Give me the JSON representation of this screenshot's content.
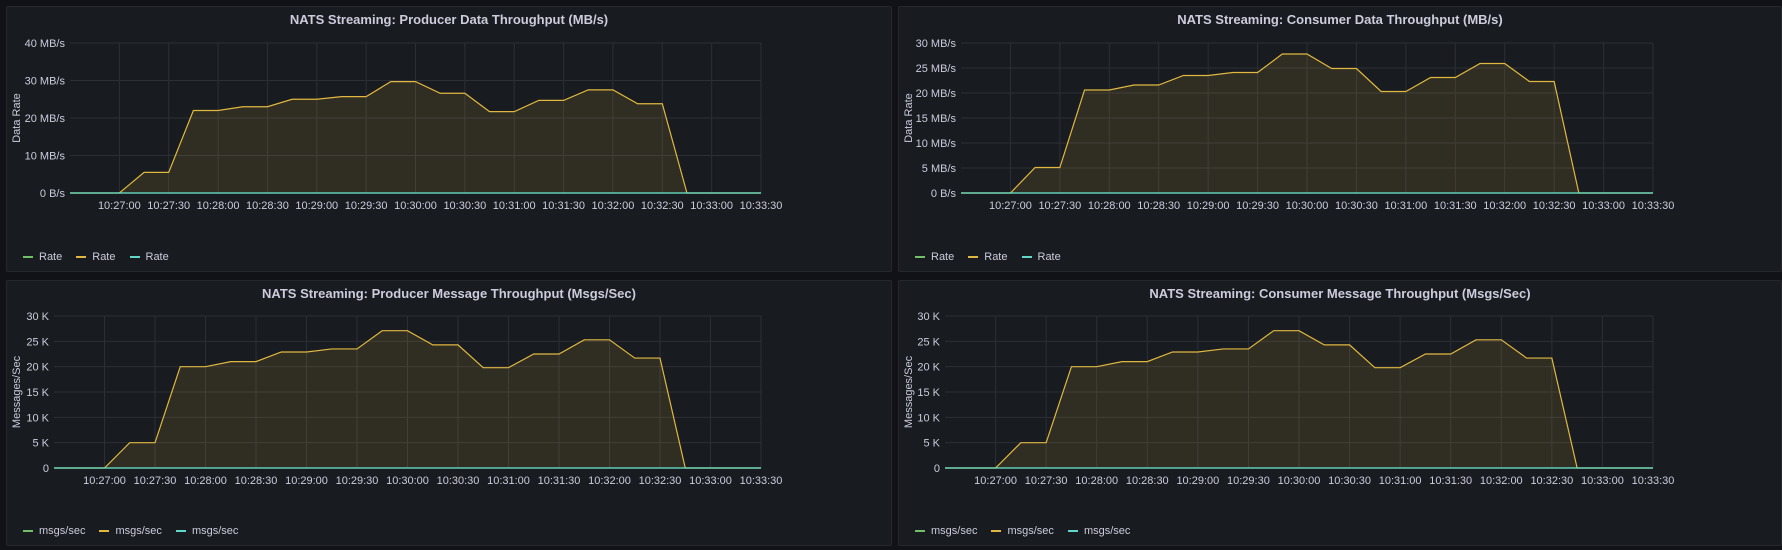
{
  "dashboard": {
    "panels": [
      {
        "title": "NATS Streaming: Producer Data Throughput (MB/s)",
        "legend": [
          {
            "label": "Rate",
            "color": "#73bf69"
          },
          {
            "label": "Rate",
            "color": "#e0b840"
          },
          {
            "label": "Rate",
            "color": "#5fd8c8"
          }
        ]
      },
      {
        "title": "NATS Streaming: Consumer Data Throughput (MB/s)",
        "legend": [
          {
            "label": "Rate",
            "color": "#73bf69"
          },
          {
            "label": "Rate",
            "color": "#e0b840"
          },
          {
            "label": "Rate",
            "color": "#5fd8c8"
          }
        ]
      },
      {
        "title": "NATS Streaming: Producer Message Throughput (Msgs/Sec)",
        "legend": [
          {
            "label": "msgs/sec",
            "color": "#73bf69"
          },
          {
            "label": "msgs/sec",
            "color": "#e0b840"
          },
          {
            "label": "msgs/sec",
            "color": "#5fd8c8"
          }
        ]
      },
      {
        "title": "NATS Streaming: Consumer Message Throughput (Msgs/Sec)",
        "legend": [
          {
            "label": "msgs/sec",
            "color": "#73bf69"
          },
          {
            "label": "msgs/sec",
            "color": "#e0b840"
          },
          {
            "label": "msgs/sec",
            "color": "#5fd8c8"
          }
        ]
      }
    ]
  },
  "chart_data": [
    {
      "type": "area",
      "title": "NATS Streaming: Producer Data Throughput (MB/s)",
      "ylabel": "Data Rate",
      "xlabel": "",
      "x": [
        "10:26:30",
        "10:26:45",
        "10:27:00",
        "10:27:15",
        "10:27:30",
        "10:27:45",
        "10:28:00",
        "10:28:15",
        "10:28:30",
        "10:28:45",
        "10:29:00",
        "10:29:15",
        "10:29:30",
        "10:29:45",
        "10:30:00",
        "10:30:15",
        "10:30:30",
        "10:30:45",
        "10:31:00",
        "10:31:15",
        "10:31:30",
        "10:31:45",
        "10:32:00",
        "10:32:15",
        "10:32:30",
        "10:32:45",
        "10:33:00",
        "10:33:15",
        "10:33:30"
      ],
      "xlim": [
        "10:26:30",
        "10:33:30"
      ],
      "ylim": [
        0,
        40
      ],
      "xticks": [
        "10:27:00",
        "10:27:30",
        "10:28:00",
        "10:28:30",
        "10:29:00",
        "10:29:30",
        "10:30:00",
        "10:30:30",
        "10:31:00",
        "10:31:30",
        "10:32:00",
        "10:32:30",
        "10:33:00",
        "10:33:30"
      ],
      "yticks": [
        0,
        10,
        20,
        30,
        40
      ],
      "ytick_labels": [
        "0 B/s",
        "10 MB/s",
        "20 MB/s",
        "30 MB/s",
        "40 MB/s"
      ],
      "series": [
        {
          "color": "#73bf69",
          "values": [
            0,
            0,
            0,
            0,
            0,
            0,
            0,
            0,
            0,
            0,
            0,
            0,
            0,
            0,
            0,
            0,
            0,
            0,
            0,
            0,
            0,
            0,
            0,
            0,
            0,
            0,
            0,
            0,
            0
          ]
        },
        {
          "color": "#e0b840",
          "fill": true,
          "values": [
            0,
            0,
            0,
            5.5,
            5.5,
            22,
            22,
            23,
            23,
            25,
            25,
            25.7,
            25.7,
            29.7,
            29.7,
            26.6,
            26.6,
            21.7,
            21.7,
            24.7,
            24.7,
            27.5,
            27.5,
            23.8,
            23.8,
            0,
            0,
            0,
            0
          ]
        },
        {
          "color": "#5fd8c8",
          "values": [
            0,
            0,
            0,
            0,
            0,
            0,
            0,
            0,
            0,
            0,
            0,
            0,
            0,
            0,
            0,
            0,
            0,
            0,
            0,
            0,
            0,
            0,
            0,
            0,
            0,
            0,
            0,
            0,
            0
          ]
        }
      ],
      "grid": true,
      "legend_position": "bottom-left"
    },
    {
      "type": "area",
      "title": "NATS Streaming: Consumer Data Throughput (MB/s)",
      "ylabel": "Data Rate",
      "xlabel": "",
      "x": [
        "10:26:30",
        "10:26:45",
        "10:27:00",
        "10:27:15",
        "10:27:30",
        "10:27:45",
        "10:28:00",
        "10:28:15",
        "10:28:30",
        "10:28:45",
        "10:29:00",
        "10:29:15",
        "10:29:30",
        "10:29:45",
        "10:30:00",
        "10:30:15",
        "10:30:30",
        "10:30:45",
        "10:31:00",
        "10:31:15",
        "10:31:30",
        "10:31:45",
        "10:32:00",
        "10:32:15",
        "10:32:30",
        "10:32:45",
        "10:33:00",
        "10:33:15",
        "10:33:30"
      ],
      "xlim": [
        "10:26:30",
        "10:33:30"
      ],
      "ylim": [
        0,
        30
      ],
      "xticks": [
        "10:27:00",
        "10:27:30",
        "10:28:00",
        "10:28:30",
        "10:29:00",
        "10:29:30",
        "10:30:00",
        "10:30:30",
        "10:31:00",
        "10:31:30",
        "10:32:00",
        "10:32:30",
        "10:33:00",
        "10:33:30"
      ],
      "yticks": [
        0,
        5,
        10,
        15,
        20,
        25,
        30
      ],
      "ytick_labels": [
        "0 B/s",
        "5 MB/s",
        "10 MB/s",
        "15 MB/s",
        "20 MB/s",
        "25 MB/s",
        "30 MB/s"
      ],
      "series": [
        {
          "color": "#73bf69",
          "values": [
            0,
            0,
            0,
            0,
            0,
            0,
            0,
            0,
            0,
            0,
            0,
            0,
            0,
            0,
            0,
            0,
            0,
            0,
            0,
            0,
            0,
            0,
            0,
            0,
            0,
            0,
            0,
            0,
            0
          ]
        },
        {
          "color": "#e0b840",
          "fill": true,
          "values": [
            0,
            0,
            0,
            5.1,
            5.1,
            20.6,
            20.6,
            21.6,
            21.6,
            23.5,
            23.5,
            24.1,
            24.1,
            27.8,
            27.8,
            24.9,
            24.9,
            20.3,
            20.3,
            23.1,
            23.1,
            25.9,
            25.9,
            22.3,
            22.3,
            0,
            0,
            0,
            0
          ]
        },
        {
          "color": "#5fd8c8",
          "values": [
            0,
            0,
            0,
            0,
            0,
            0,
            0,
            0,
            0,
            0,
            0,
            0,
            0,
            0,
            0,
            0,
            0,
            0,
            0,
            0,
            0,
            0,
            0,
            0,
            0,
            0,
            0,
            0,
            0
          ]
        }
      ],
      "grid": true,
      "legend_position": "bottom-left"
    },
    {
      "type": "area",
      "title": "NATS Streaming: Producer Message Throughput (Msgs/Sec)",
      "ylabel": "Messages/Sec",
      "xlabel": "",
      "x": [
        "10:26:30",
        "10:26:45",
        "10:27:00",
        "10:27:15",
        "10:27:30",
        "10:27:45",
        "10:28:00",
        "10:28:15",
        "10:28:30",
        "10:28:45",
        "10:29:00",
        "10:29:15",
        "10:29:30",
        "10:29:45",
        "10:30:00",
        "10:30:15",
        "10:30:30",
        "10:30:45",
        "10:31:00",
        "10:31:15",
        "10:31:30",
        "10:31:45",
        "10:32:00",
        "10:32:15",
        "10:32:30",
        "10:32:45",
        "10:33:00",
        "10:33:15",
        "10:33:30"
      ],
      "xlim": [
        "10:26:30",
        "10:33:30"
      ],
      "ylim": [
        0,
        30000
      ],
      "xticks": [
        "10:27:00",
        "10:27:30",
        "10:28:00",
        "10:28:30",
        "10:29:00",
        "10:29:30",
        "10:30:00",
        "10:30:30",
        "10:31:00",
        "10:31:30",
        "10:32:00",
        "10:32:30",
        "10:33:00",
        "10:33:30"
      ],
      "yticks": [
        0,
        5000,
        10000,
        15000,
        20000,
        25000,
        30000
      ],
      "ytick_labels": [
        "0",
        "5 K",
        "10 K",
        "15 K",
        "20 K",
        "25 K",
        "30 K"
      ],
      "series": [
        {
          "color": "#73bf69",
          "values": [
            0,
            0,
            0,
            0,
            0,
            0,
            0,
            0,
            0,
            0,
            0,
            0,
            0,
            0,
            0,
            0,
            0,
            0,
            0,
            0,
            0,
            0,
            0,
            0,
            0,
            0,
            0,
            0,
            0
          ]
        },
        {
          "color": "#e0b840",
          "fill": true,
          "values": [
            0,
            0,
            0,
            5000,
            5000,
            20000,
            20000,
            21000,
            21000,
            22900,
            22900,
            23500,
            23500,
            27100,
            27100,
            24300,
            24300,
            19800,
            19800,
            22500,
            22500,
            25300,
            25300,
            21700,
            21700,
            0,
            0,
            0,
            0
          ]
        },
        {
          "color": "#5fd8c8",
          "values": [
            0,
            0,
            0,
            0,
            0,
            0,
            0,
            0,
            0,
            0,
            0,
            0,
            0,
            0,
            0,
            0,
            0,
            0,
            0,
            0,
            0,
            0,
            0,
            0,
            0,
            0,
            0,
            0,
            0
          ]
        }
      ],
      "grid": true,
      "legend_position": "bottom-left"
    },
    {
      "type": "area",
      "title": "NATS Streaming: Consumer Message Throughput (Msgs/Sec)",
      "ylabel": "Messages/Sec",
      "xlabel": "",
      "x": [
        "10:26:30",
        "10:26:45",
        "10:27:00",
        "10:27:15",
        "10:27:30",
        "10:27:45",
        "10:28:00",
        "10:28:15",
        "10:28:30",
        "10:28:45",
        "10:29:00",
        "10:29:15",
        "10:29:30",
        "10:29:45",
        "10:30:00",
        "10:30:15",
        "10:30:30",
        "10:30:45",
        "10:31:00",
        "10:31:15",
        "10:31:30",
        "10:31:45",
        "10:32:00",
        "10:32:15",
        "10:32:30",
        "10:32:45",
        "10:33:00",
        "10:33:15",
        "10:33:30"
      ],
      "xlim": [
        "10:26:30",
        "10:33:30"
      ],
      "ylim": [
        0,
        30000
      ],
      "xticks": [
        "10:27:00",
        "10:27:30",
        "10:28:00",
        "10:28:30",
        "10:29:00",
        "10:29:30",
        "10:30:00",
        "10:30:30",
        "10:31:00",
        "10:31:30",
        "10:32:00",
        "10:32:30",
        "10:33:00",
        "10:33:30"
      ],
      "yticks": [
        0,
        5000,
        10000,
        15000,
        20000,
        25000,
        30000
      ],
      "ytick_labels": [
        "0",
        "5 K",
        "10 K",
        "15 K",
        "20 K",
        "25 K",
        "30 K"
      ],
      "series": [
        {
          "color": "#73bf69",
          "values": [
            0,
            0,
            0,
            0,
            0,
            0,
            0,
            0,
            0,
            0,
            0,
            0,
            0,
            0,
            0,
            0,
            0,
            0,
            0,
            0,
            0,
            0,
            0,
            0,
            0,
            0,
            0,
            0,
            0
          ]
        },
        {
          "color": "#e0b840",
          "fill": true,
          "values": [
            0,
            0,
            0,
            5000,
            5000,
            20000,
            20000,
            21000,
            21000,
            22900,
            22900,
            23500,
            23500,
            27100,
            27100,
            24300,
            24300,
            19800,
            19800,
            22500,
            22500,
            25300,
            25300,
            21700,
            21700,
            0,
            0,
            0,
            0
          ]
        },
        {
          "color": "#5fd8c8",
          "values": [
            0,
            0,
            0,
            0,
            0,
            0,
            0,
            0,
            0,
            0,
            0,
            0,
            0,
            0,
            0,
            0,
            0,
            0,
            0,
            0,
            0,
            0,
            0,
            0,
            0,
            0,
            0,
            0,
            0
          ]
        }
      ],
      "grid": true,
      "legend_position": "bottom-left"
    }
  ]
}
